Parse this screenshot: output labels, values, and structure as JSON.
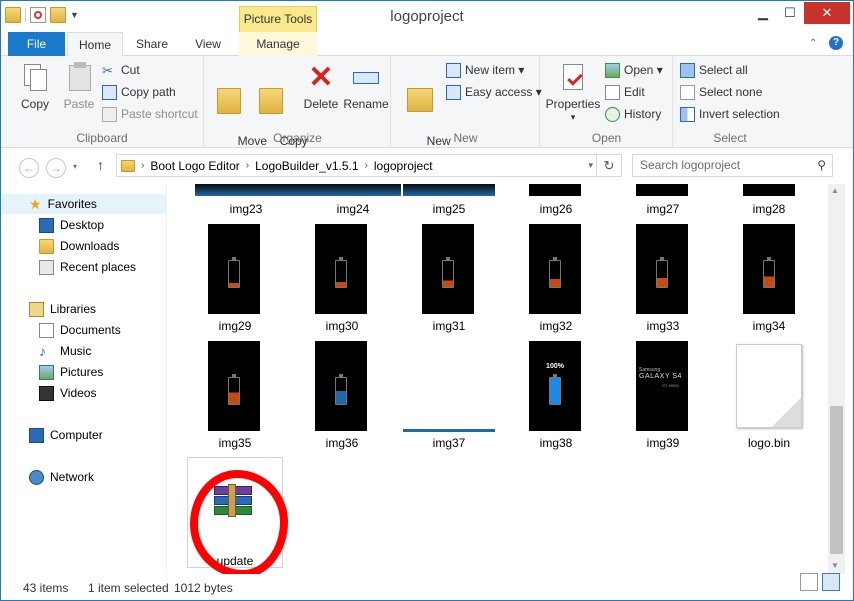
{
  "window": {
    "title": "logoproject",
    "context_tab": "Picture Tools",
    "controls": [
      "minimize",
      "maximize",
      "close"
    ]
  },
  "tabs": [
    {
      "label": "File"
    },
    {
      "label": "Home"
    },
    {
      "label": "Share"
    },
    {
      "label": "View"
    },
    {
      "label": "Manage"
    }
  ],
  "ribbon": {
    "clipboard": {
      "label": "Clipboard",
      "copy": "Copy",
      "paste": "Paste",
      "cut": "Cut",
      "copy_path": "Copy path",
      "paste_shortcut": "Paste shortcut"
    },
    "organize": {
      "label": "Organize",
      "move_to": "Move\nto ▾",
      "copy_to": "Copy\nto ▾",
      "delete": "Delete",
      "rename": "Rename"
    },
    "new": {
      "label": "New",
      "new_folder": "New\nfolder",
      "new_item": "New item ▾",
      "easy_access": "Easy access ▾"
    },
    "open": {
      "label": "Open",
      "properties": "Properties",
      "open": "Open ▾",
      "edit": "Edit",
      "history": "History"
    },
    "select": {
      "label": "Select",
      "select_all": "Select all",
      "select_none": "Select none",
      "invert": "Invert selection"
    }
  },
  "address": {
    "crumbs": [
      "Boot Logo Editor",
      "LogoBuilder_v1.5.1",
      "logoproject"
    ],
    "search_placeholder": "Search logoproject"
  },
  "nav": {
    "favorites": "Favorites",
    "desktop": "Desktop",
    "downloads": "Downloads",
    "recent": "Recent places",
    "libraries": "Libraries",
    "documents": "Documents",
    "music": "Music",
    "pictures": "Pictures",
    "videos": "Videos",
    "computer": "Computer",
    "network": "Network"
  },
  "files": [
    {
      "name": "img23"
    },
    {
      "name": "img24"
    },
    {
      "name": "img25"
    },
    {
      "name": "img26"
    },
    {
      "name": "img27"
    },
    {
      "name": "img28"
    },
    {
      "name": "img29"
    },
    {
      "name": "img30"
    },
    {
      "name": "img31"
    },
    {
      "name": "img32"
    },
    {
      "name": "img33"
    },
    {
      "name": "img34"
    },
    {
      "name": "img35"
    },
    {
      "name": "img36"
    },
    {
      "name": "img37"
    },
    {
      "name": "img38"
    },
    {
      "name": "img39"
    },
    {
      "name": "logo.bin"
    },
    {
      "name": "update"
    }
  ],
  "thumb_text": {
    "img38": "100%",
    "img39_brand": "Samsung",
    "img39_title": "GALAXY S4",
    "img39_model": "GT-I9500"
  },
  "status": {
    "count": "43 items",
    "selected": "1 item selected",
    "size": "1012 bytes"
  },
  "colors": {
    "accent": "#1979ca",
    "context_tab": "#f9e98a",
    "annotation_circle": "#ff0000",
    "close": "#c7332a"
  }
}
